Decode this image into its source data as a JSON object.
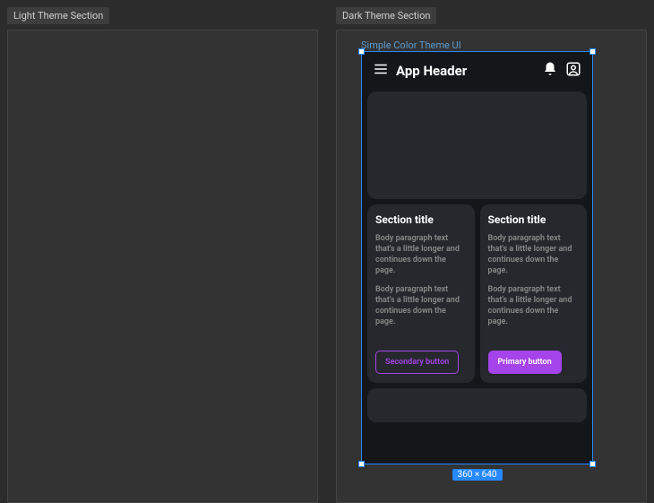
{
  "sections": {
    "light": {
      "label": "Light Theme Section"
    },
    "dark": {
      "label": "Dark Theme Section"
    }
  },
  "frame_label": "Simple Color Theme UI",
  "dimensions_badge": "360 × 640",
  "app": {
    "header_title": "App Header",
    "cards": [
      {
        "title": "Section title",
        "body1": "Body paragraph text that's a little longer and continues down the page.",
        "body2": "Body paragraph text that's a little longer and continues down the page.",
        "button_label": "Secondary button"
      },
      {
        "title": "Section title",
        "body1": "Body paragraph text that's a little longer and continues down the page.",
        "body2": "Body paragraph text that's a little longer and continues down the page.",
        "button_label": "Primary button"
      }
    ]
  },
  "colors": {
    "accent": "#a544ea",
    "selection": "#2689ff"
  }
}
